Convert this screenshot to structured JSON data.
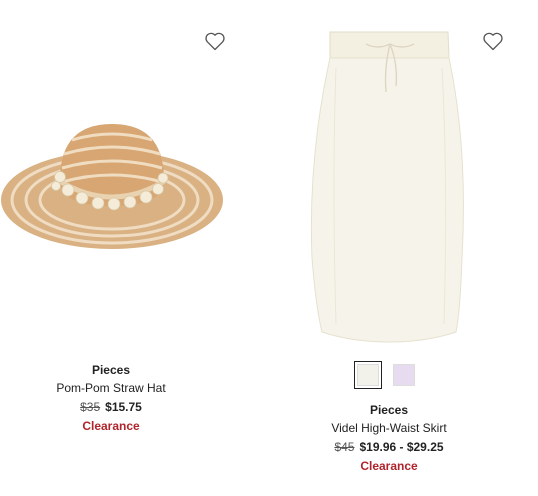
{
  "products": [
    {
      "brand": "Pieces",
      "name": "Pom-Pom Straw Hat",
      "was_price": "$35",
      "price": "$15.75",
      "badge": "Clearance",
      "favorite_icon": "heart-outline-icon"
    },
    {
      "brand": "Pieces",
      "name": "Videl High-Waist Skirt",
      "was_price": "$45",
      "price": "$19.96 - $29.25",
      "badge": "Clearance",
      "favorite_icon": "heart-outline-icon",
      "swatches": [
        {
          "color": "#f2f1ea",
          "selected": true
        },
        {
          "color": "#e7dcef",
          "selected": false
        }
      ]
    }
  ],
  "colors": {
    "clearance": "#b0242c",
    "text": "#222222"
  }
}
